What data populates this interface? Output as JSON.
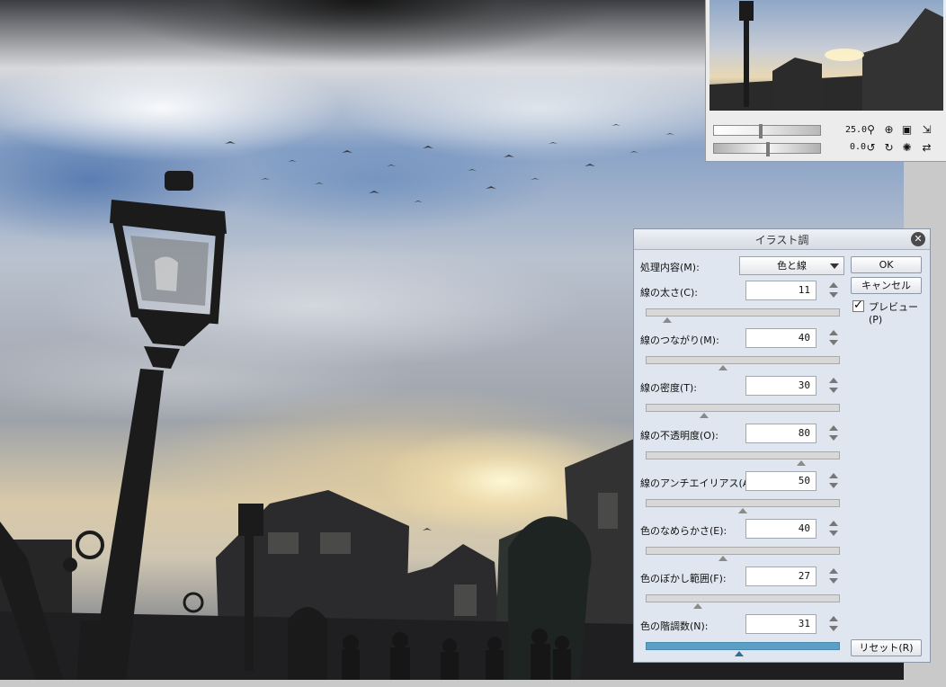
{
  "navigator": {
    "zoom_value": "25.0",
    "rotate_value": "0.0",
    "zoom_slider_level": 0.4,
    "rotate_slider_level": 0.5
  },
  "dialog": {
    "title": "イラスト調",
    "process_label": "処理内容(M):",
    "process_value": "色と線",
    "ok_label": "OK",
    "cancel_label": "キャンセル",
    "preview_label": "プレビュー(P)",
    "preview_checked": true,
    "reset_label": "リセット(R)",
    "params": [
      {
        "label": "線の太さ(C):",
        "value": "11",
        "level": 0.11
      },
      {
        "label": "線のつながり(M):",
        "value": "40",
        "level": 0.4
      },
      {
        "label": "線の密度(T):",
        "value": "30",
        "level": 0.3
      },
      {
        "label": "線の不透明度(O):",
        "value": "80",
        "level": 0.8
      },
      {
        "label": "線のアンチエイリアス(A):",
        "value": "50",
        "level": 0.5
      },
      {
        "label": "色のなめらかさ(E):",
        "value": "40",
        "level": 0.4
      },
      {
        "label": "色のぼかし範囲(F):",
        "value": "27",
        "level": 0.27
      },
      {
        "label": "色の階調数(N):",
        "value": "31",
        "level": 0.48
      }
    ]
  }
}
